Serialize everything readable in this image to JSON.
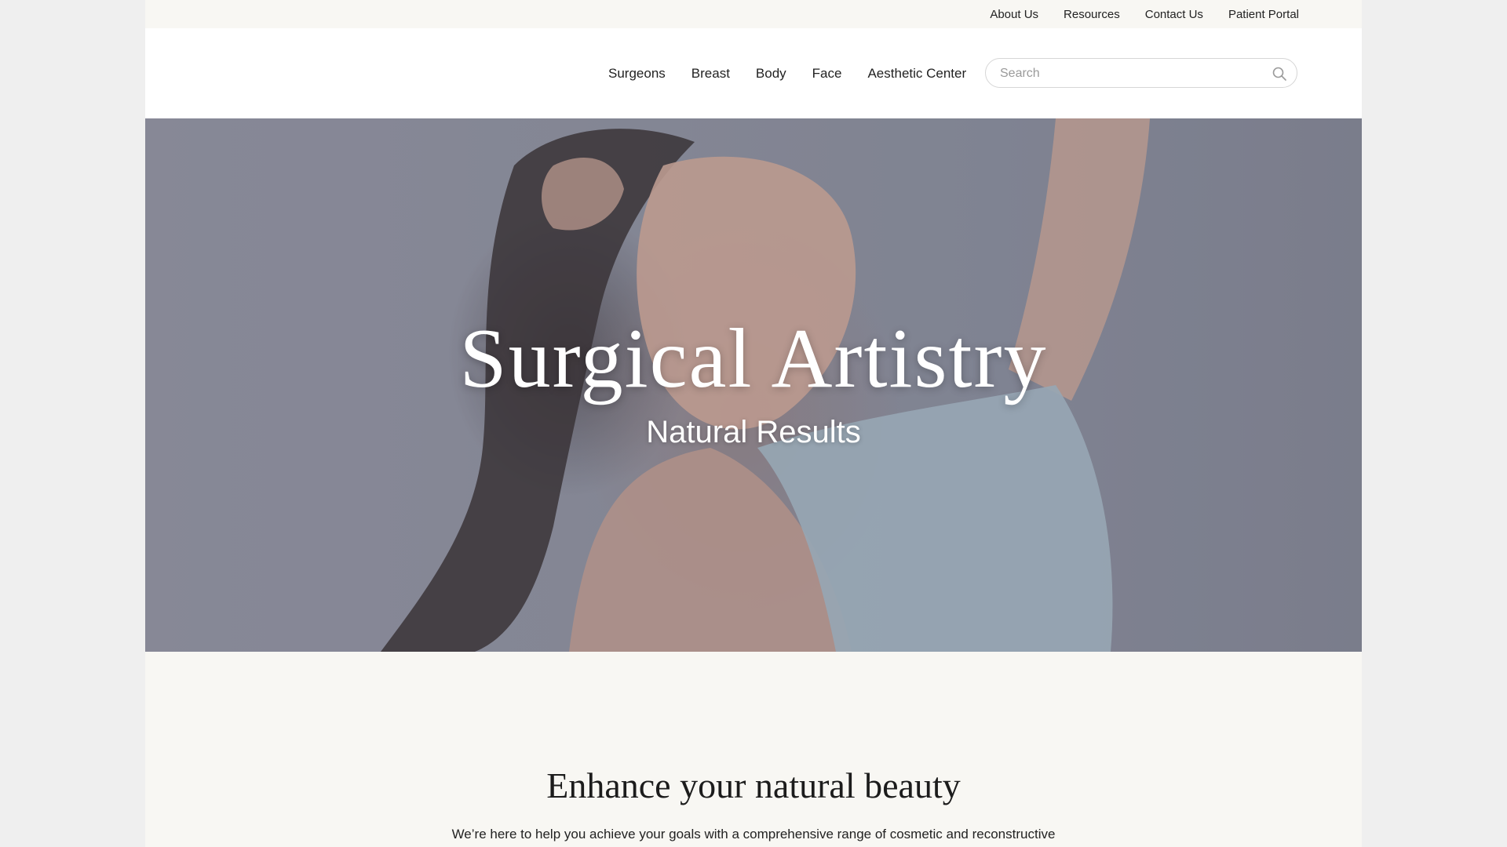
{
  "utility_nav": [
    "About Us",
    "Resources",
    "Contact Us",
    "Patient Portal"
  ],
  "main_nav": [
    "Surgeons",
    "Breast",
    "Body",
    "Face",
    "Aesthetic Center"
  ],
  "search": {
    "placeholder": "Search",
    "icon": "search-icon"
  },
  "hero": {
    "title": "Surgical Artistry",
    "subtitle": "Natural Results"
  },
  "intro": {
    "title": "Enhance your natural beauty",
    "text": "We’re here to help you achieve your goals with a comprehensive range of cosmetic and reconstructive"
  },
  "colors": {
    "page_background": "#f8f7f3",
    "header_background": "#ffffff",
    "hero_tint": "#8a8c99",
    "text": "#1d1d1d"
  }
}
